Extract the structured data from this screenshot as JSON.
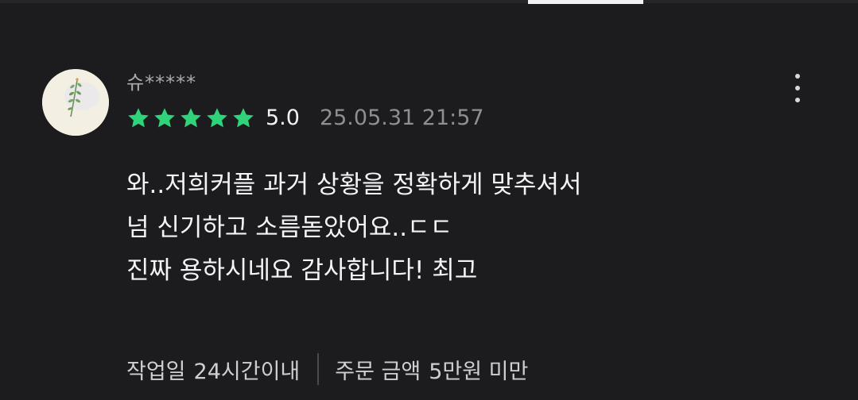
{
  "review": {
    "reviewer_name": "슈*****",
    "rating": 5,
    "rating_max": 5,
    "score_text": "5.0",
    "date": "25.05.31 21:57",
    "body_lines": [
      "와..저희커플 과거 상황을 정확하게 맞추셔서",
      "넘 신기하고 소름돋았어요..ㄷㄷ",
      "진짜 용하시네요 감사합니다! 최고"
    ],
    "meta": {
      "work_days_label": "작업일",
      "work_days_value": "24시간이내",
      "order_amount_label": "주문 금액",
      "order_amount_value": "5만원 미만"
    }
  },
  "colors": {
    "background": "#1c1c1e",
    "star": "#2fd37a",
    "text_primary": "#f4f4f6",
    "text_secondary": "#8e8e93"
  },
  "icons": {
    "avatar": "plant-sprig-avatar",
    "star": "star-icon",
    "more": "more-vertical-icon"
  }
}
